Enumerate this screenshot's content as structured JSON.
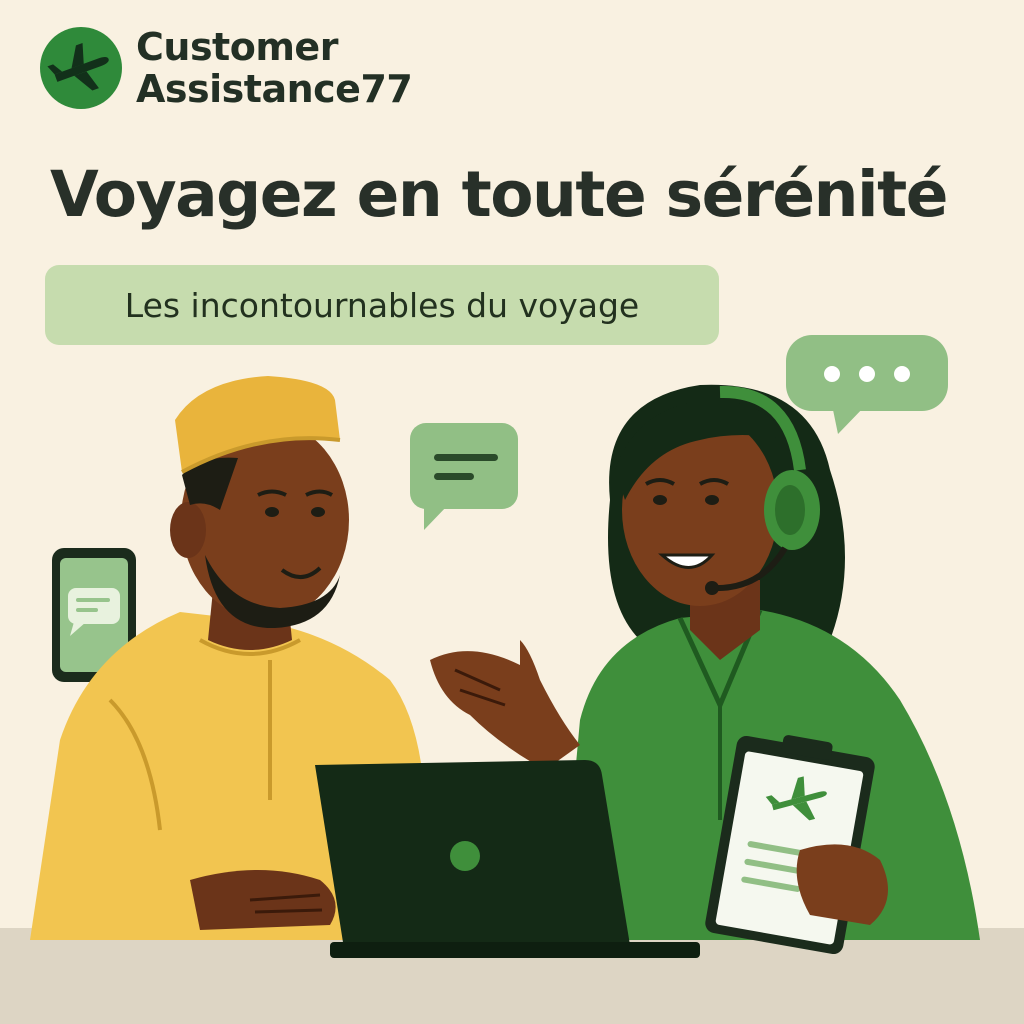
{
  "brand": {
    "name_line1": "Customer",
    "name_line2": "Assistance77",
    "logo_icon": "airplane-icon",
    "logo_color": "#2f8a3a"
  },
  "headline": "Voyagez en toute sérénité",
  "subtitle": "Les incontournables du voyage",
  "colors": {
    "background": "#f9f1e1",
    "accent_green": "#3f8f3b",
    "pill_green": "#c6dcae",
    "text_dark": "#283029",
    "yellow": "#f2c550"
  },
  "illustration": {
    "icons": [
      "typing-bubble-icon",
      "chat-bubble-icon",
      "phone-chat-icon",
      "laptop-icon",
      "clipboard-plane-icon",
      "headset-icon"
    ]
  }
}
